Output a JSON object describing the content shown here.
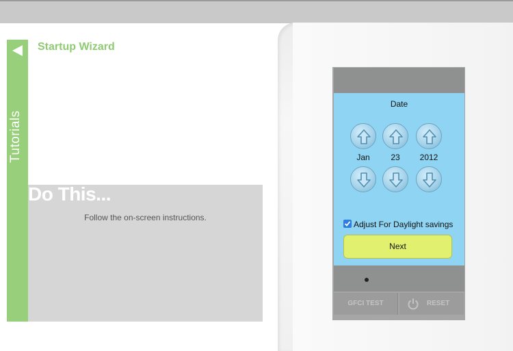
{
  "tutorial_tab": {
    "label": "Tutorials",
    "arrow_icon": "triangle-left-icon"
  },
  "wizard": {
    "title": "Startup Wizard"
  },
  "instructions": {
    "heading": "Do This...",
    "text": "Follow the on-screen instructions."
  },
  "device": {
    "screen": {
      "title": "Date",
      "month": "Jan",
      "day": "23",
      "year": "2012",
      "daylight_checked": true,
      "daylight_label": "Adjust For Daylight savings",
      "next_label": "Next"
    },
    "buttons": {
      "gfci_label": "GFCI TEST",
      "reset_label": "RESET"
    }
  },
  "colors": {
    "accent_green": "#97cf7b",
    "screen_blue": "#8fd4f2",
    "next_button": "#e1f06e"
  }
}
